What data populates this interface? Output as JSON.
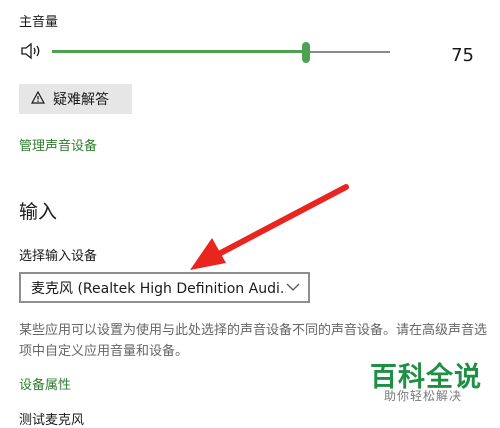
{
  "output": {
    "master_volume_label": "主音量",
    "volume": 75,
    "volume_text": "75",
    "troubleshoot_label": "疑难解答",
    "manage_link": "管理声音设备"
  },
  "input": {
    "section_title": "输入",
    "choose_label": "选择输入设备",
    "selected_device": "麦克风 (Realtek High Definition Audi...",
    "description": "某些应用可以设置为使用与此处选择的声音设备不同的声音设备。请在高级声音选项中自定义应用音量和设备。",
    "properties_link": "设备属性",
    "next_label_cut": "测试麦克风"
  },
  "watermark": {
    "main": "百科全说",
    "sub": "助你轻松解决"
  },
  "colors": {
    "accent": "#4ea14e",
    "link": "#2f7d2f",
    "arrow": "#e8251f"
  },
  "icons": [
    "speaker-icon",
    "warning-icon",
    "chevron-down-icon",
    "annotation-arrow"
  ]
}
